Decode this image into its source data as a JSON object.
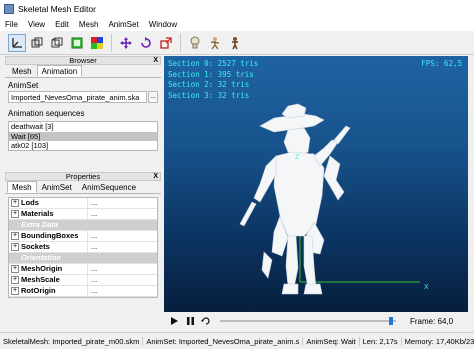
{
  "window": {
    "title": "Skeletal Mesh Editor"
  },
  "menu": [
    "File",
    "View",
    "Edit",
    "Mesh",
    "AnimSet",
    "Window"
  ],
  "toolbar": {
    "icons": [
      "axes-icon",
      "mesh-icon",
      "mesh-wire-icon",
      "material-icon",
      "color-grid-icon",
      "move-icon",
      "rotate-icon",
      "scale-icon",
      "skeleton-icon",
      "anim-icon",
      "character-icon"
    ]
  },
  "browser": {
    "title": "Browser",
    "close": "X",
    "tabs": [
      "Mesh",
      "Animation"
    ],
    "animset_label": "AnimSet",
    "animset_value": "Imported_NevesOma_pirate_anim.ska",
    "browse_btn": "...",
    "sequences_label": "Animation sequences",
    "sequences": [
      "deathwait [3]",
      "Wait [65]",
      "atk02 [103]"
    ],
    "selected_sequence": "Wait [65]"
  },
  "properties": {
    "title": "Properties",
    "close": "X",
    "tabs": [
      "Mesh",
      "AnimSet",
      "AnimSequence"
    ],
    "rows": [
      {
        "name": "Lods",
        "value": "...",
        "type": "prop"
      },
      {
        "name": "Materials",
        "value": "...",
        "type": "prop"
      },
      {
        "name": "Extra Data",
        "type": "group"
      },
      {
        "name": "BoundingBoxes",
        "value": "...",
        "type": "prop"
      },
      {
        "name": "Sockets",
        "value": "...",
        "type": "prop"
      },
      {
        "name": "Orientation",
        "type": "group"
      },
      {
        "name": "MeshOrigin",
        "value": "...",
        "type": "prop"
      },
      {
        "name": "MeshScale",
        "value": "...",
        "type": "prop"
      },
      {
        "name": "RotOrigin",
        "value": "...",
        "type": "prop"
      }
    ]
  },
  "viewport": {
    "stats": [
      "Section 0: 2527 tris",
      "Section 1: 395 tris",
      "Section 2: 32 tris",
      "Section 3: 32 tris"
    ],
    "fps": "FPS:  62,5",
    "axis_z": "Z",
    "axis_x": "X",
    "colors": {
      "stats": "#3af0f0",
      "axis_line": "#2ec52e",
      "bg_top": "#1f63a3",
      "bg_bottom": "#071f3d"
    }
  },
  "playback": {
    "frame": "Frame: 64,0",
    "progress": 0.985
  },
  "status": {
    "mesh": "SkeletalMesh: Imported_pirate_m00.skm",
    "animset": "AnimSet: Imported_NevesOma_pirate_anim.s",
    "animseq": "AnimSeq: Wait",
    "len": "Len: 2,17s",
    "memory": "Memory: 17,40Kb/23"
  }
}
